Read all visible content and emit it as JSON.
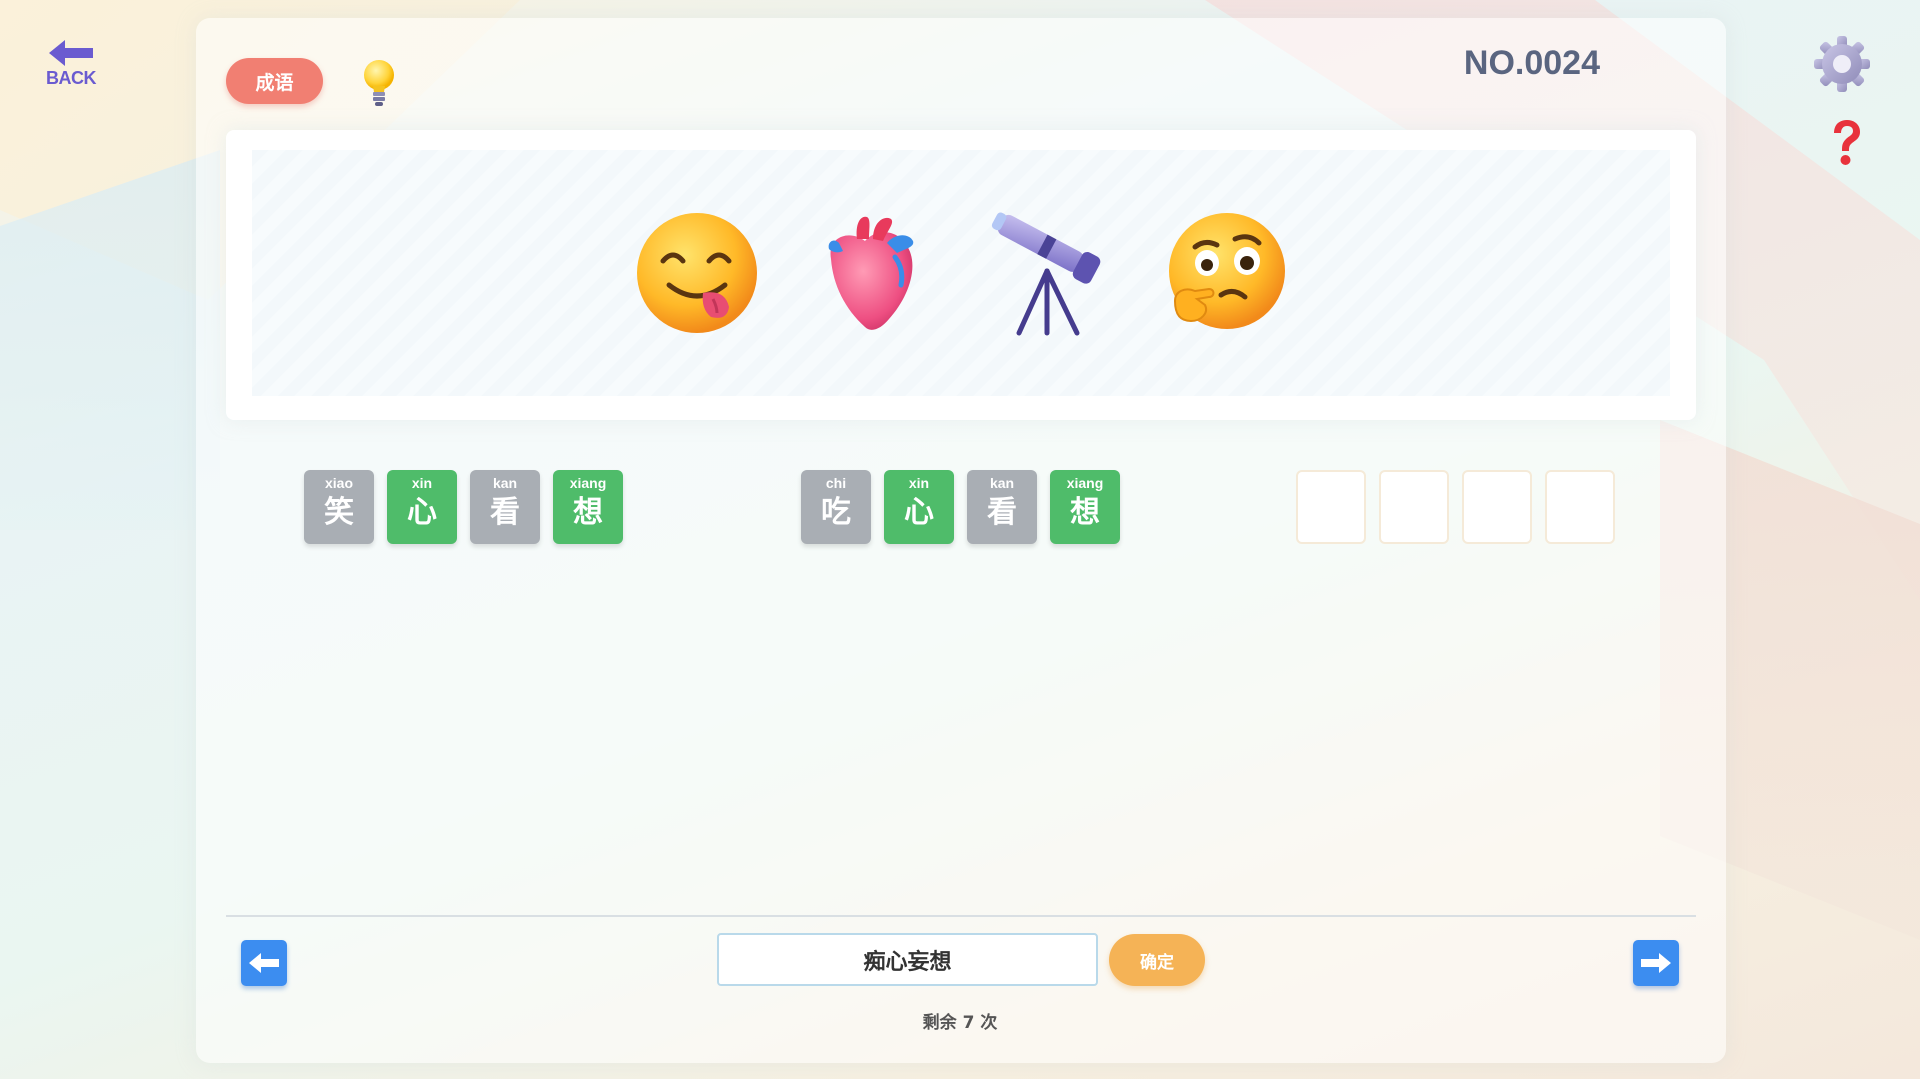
{
  "header": {
    "back_label": "BACK",
    "category_label": "成语",
    "level_number": "NO.0024"
  },
  "puzzle": {
    "emojis": [
      "face-savoring-food-icon",
      "anatomical-heart-icon",
      "telescope-icon",
      "thinking-face-icon"
    ]
  },
  "tile_groups": [
    {
      "tiles": [
        {
          "pinyin": "xiao",
          "hanzi": "笑",
          "status": "gray"
        },
        {
          "pinyin": "xin",
          "hanzi": "心",
          "status": "green"
        },
        {
          "pinyin": "kan",
          "hanzi": "看",
          "status": "gray"
        },
        {
          "pinyin": "xiang",
          "hanzi": "想",
          "status": "green"
        }
      ]
    },
    {
      "tiles": [
        {
          "pinyin": "chi",
          "hanzi": "吃",
          "status": "gray"
        },
        {
          "pinyin": "xin",
          "hanzi": "心",
          "status": "green"
        },
        {
          "pinyin": "kan",
          "hanzi": "看",
          "status": "gray"
        },
        {
          "pinyin": "xiang",
          "hanzi": "想",
          "status": "green"
        }
      ]
    }
  ],
  "empty_slots": 4,
  "answer": {
    "value": "痴心妄想",
    "confirm_label": "确定",
    "remaining_text": "剩余 7 次"
  },
  "colors": {
    "green": "#4fbc6a",
    "gray": "#a9aeb4",
    "accent_red": "#f17f72",
    "accent_orange": "#f5b356",
    "nav_blue": "#3c8df0"
  }
}
